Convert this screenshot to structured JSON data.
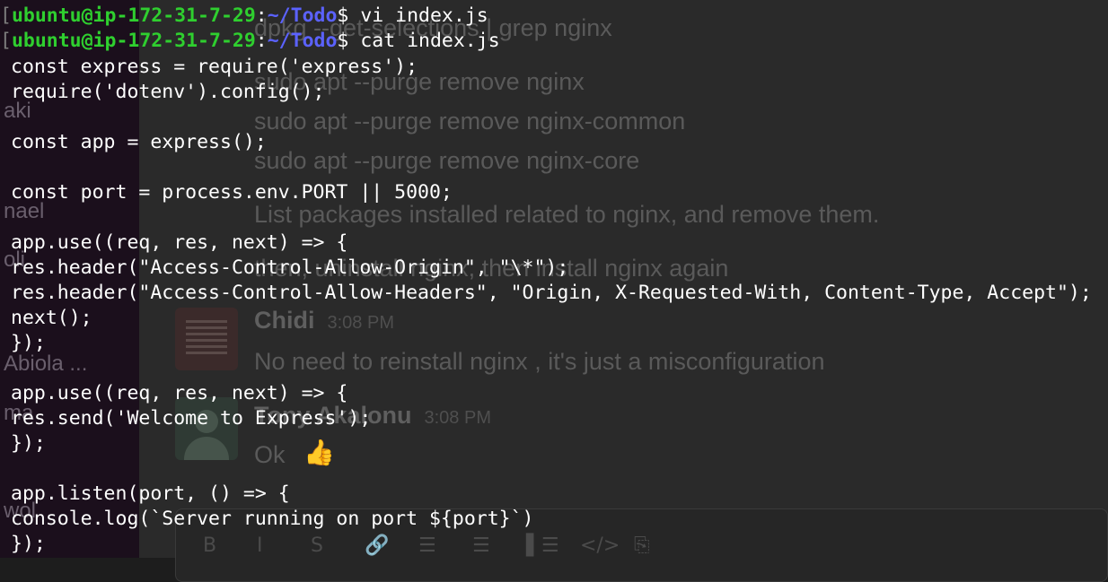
{
  "chat": {
    "sidebar_names": [
      "aki",
      "nael",
      "oli",
      "Abiola ...",
      "ma",
      "wol"
    ],
    "lines": {
      "cmd_dpkg": "dpkg --get-selections | grep nginx",
      "cmd_purge1": "sudo apt --purge remove nginx",
      "cmd_purge2": "sudo apt --purge remove nginx-common",
      "cmd_purge3": "sudo apt --purge remove nginx-core",
      "msg_list": "List packages installed related to nginx, and remove them.",
      "msg_reinstall": "then, uninstall nginx, then install nginx again",
      "msg_chidi": "No need to reinstall nginx , it's just a misconfiguration",
      "msg_ok": "Ok"
    },
    "authors": {
      "chidi": "Chidi",
      "chidi_time": "3:08 PM",
      "tony": "Tony Akalonu",
      "tony_time": "3:08 PM"
    },
    "composer_tools": [
      "B",
      "I",
      "S",
      "🔗",
      "☰",
      "☰",
      "▌☰",
      "</>",
      "⎘"
    ]
  },
  "terminal": {
    "prompt": {
      "bracket": "[",
      "user_host": "ubuntu@ip-172-31-7-29",
      "colon": ":",
      "path": "~/Todo",
      "symbol": "$"
    },
    "commands": [
      "vi index.js",
      "cat index.js"
    ],
    "file_lines": [
      "const express = require('express');",
      "require('dotenv').config();",
      "",
      "const app = express();",
      "",
      "const port = process.env.PORT || 5000;",
      "",
      "app.use((req, res, next) => {",
      "res.header(\"Access-Control-Allow-Origin\", \"\\*\");",
      "res.header(\"Access-Control-Allow-Headers\", \"Origin, X-Requested-With, Content-Type, Accept\");",
      "next();",
      "});",
      "",
      "app.use((req, res, next) => {",
      "res.send('Welcome to Express');",
      "});",
      "",
      "app.listen(port, () => {",
      "console.log(`Server running on port ${port}`)",
      "});"
    ]
  }
}
